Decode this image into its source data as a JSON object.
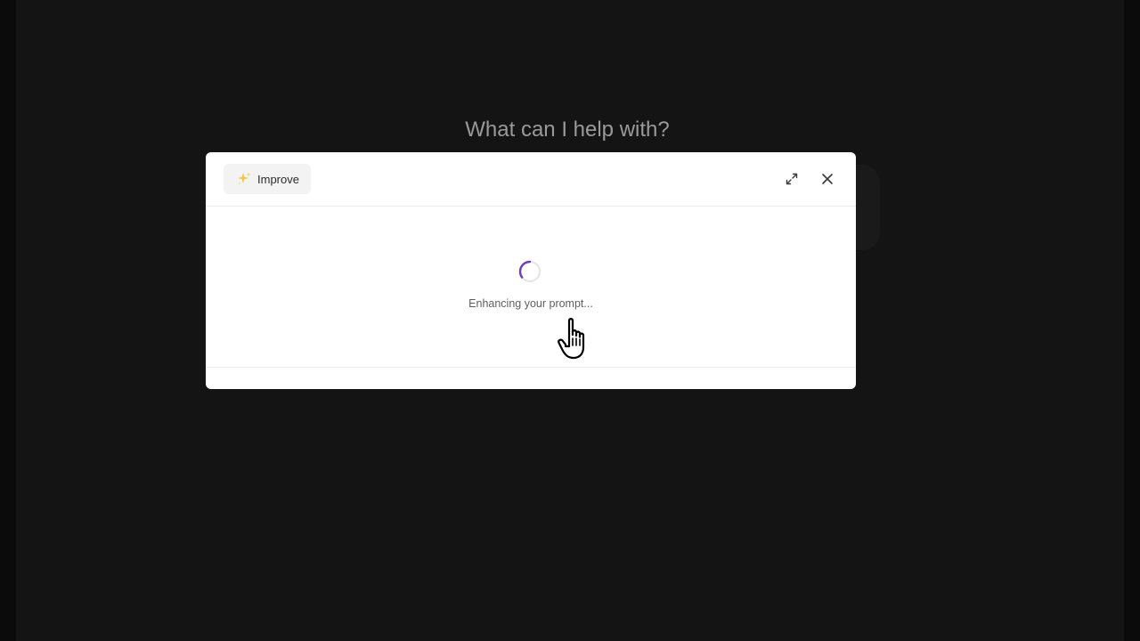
{
  "page": {
    "greeting": "What can I help with?"
  },
  "modal": {
    "improve_label": "Improve",
    "improve_icon": "sparkles-icon",
    "expand_icon": "expand-icon",
    "close_icon": "close-icon",
    "status_text": "Enhancing your prompt...",
    "spinner_color": "#6a3fc1"
  },
  "cursor": {
    "icon": "hand-pointer-cursor-icon"
  }
}
